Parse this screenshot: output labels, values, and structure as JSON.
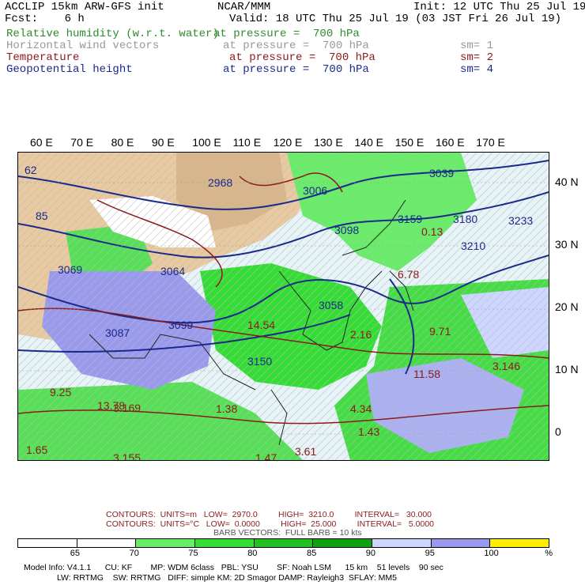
{
  "header": {
    "line1_left": "ACCLIP 15km ARW-GFS init",
    "line1_center": "NCAR/MMM",
    "line1_right": "Init: 12 UTC Thu 25 Jul 19",
    "line2_left": "Fcst:    6 h",
    "line2_right": "Valid: 18 UTC Thu 25 Jul 19 (03 JST Fri 26 Jul 19)"
  },
  "fields": [
    {
      "name": "Relative humidity (w.r.t. water)",
      "level": "at pressure =  700 hPa",
      "sm": "",
      "color": "#2e8b2e"
    },
    {
      "name": "Horizontal wind vectors",
      "level": "at pressure =  700 hPa",
      "sm": "sm= 1",
      "color": "#999999"
    },
    {
      "name": "Temperature",
      "level": "at pressure =  700 hPa",
      "sm": "sm= 2",
      "color": "#8b1a1a"
    },
    {
      "name": "Geopotential height",
      "level": "at pressure =  700 hPa",
      "sm": "sm= 4",
      "color": "#1a2a8b"
    }
  ],
  "axes": {
    "lon_labels": [
      "60 E",
      "70 E",
      "80 E",
      "90 E",
      "100 E",
      "110 E",
      "120 E",
      "130 E",
      "140 E",
      "150 E",
      "160 E",
      "170 E"
    ],
    "lat_labels": [
      "40 N",
      "30 N",
      "20 N",
      "10 N",
      "0"
    ]
  },
  "map_labels": [
    "62",
    "85",
    "2968",
    "3006",
    "3039",
    "3069",
    "3064",
    "3099",
    "3087",
    "3150",
    "3159",
    "3180",
    "3210",
    "3233",
    "3058",
    "3098",
    "14.54",
    "2.16",
    "9.71",
    "11.58",
    "13.78",
    "9.25",
    "1.38",
    "4.34",
    "1.43",
    "3.61",
    "1.65",
    "3.155",
    "1.47",
    "3.146",
    "3.169",
    "0.13",
    "6.78"
  ],
  "contours": {
    "line1": "CONTOURS:  UNITS=m   LOW=  2970.0         HIGH=  3210.0         INTERVAL=   30.000",
    "line2": "CONTOURS:  UNITS=°C   LOW=  0.0000         HIGH=  25.000         INTERVAL=   5.0000",
    "line3": "BARB VECTORS:  FULL BARB = 10 kts"
  },
  "colorbar": {
    "colors": [
      "#ffffff",
      "#ffffff",
      "#66ee66",
      "#33dd33",
      "#22c022",
      "#11a011",
      "#ccd6ff",
      "#9999ee",
      "#ffee00"
    ],
    "labels": [
      "65",
      "70",
      "75",
      "80",
      "85",
      "90",
      "95",
      "100",
      "%"
    ]
  },
  "model_info": {
    "line1": "Model Info: V4.1.1      CU: KF        MP: WDM 6class   PBL: YSU        SF: Noah LSM      15 km    51 levels    90 sec",
    "line2": "LW: RRTMG    SW: RRTMG   DIFF: simple KM: 2D Smagor DAMP: Rayleigh3  SFLAY: MM5"
  }
}
